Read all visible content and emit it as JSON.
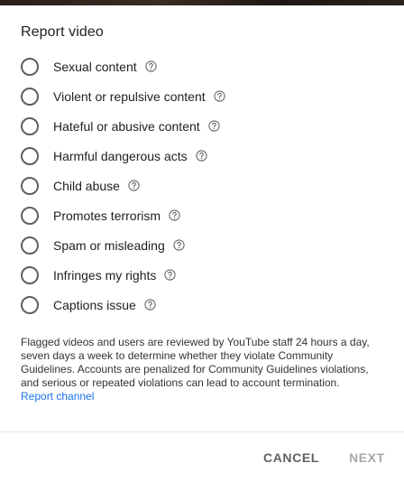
{
  "dialog": {
    "title": "Report video",
    "options": [
      {
        "label": "Sexual content"
      },
      {
        "label": "Violent or repulsive content"
      },
      {
        "label": "Hateful or abusive content"
      },
      {
        "label": "Harmful dangerous acts"
      },
      {
        "label": "Child abuse"
      },
      {
        "label": "Promotes terrorism"
      },
      {
        "label": "Spam or misleading"
      },
      {
        "label": "Infringes my rights"
      },
      {
        "label": "Captions issue"
      }
    ],
    "description": "Flagged videos and users are reviewed by YouTube staff 24 hours a day, seven days a week to determine whether they violate Community Guidelines. Accounts are penalized for Community Guidelines violations, and serious or repeated violations can lead to account termination.",
    "report_channel_link": "Report channel",
    "cancel_label": "CANCEL",
    "next_label": "NEXT"
  },
  "icons": {
    "option_help": "help-circle-icon"
  },
  "colors": {
    "link": "#1a73e8",
    "next_disabled": "#a8a8a8",
    "radio_border": "#5f5f5f"
  }
}
